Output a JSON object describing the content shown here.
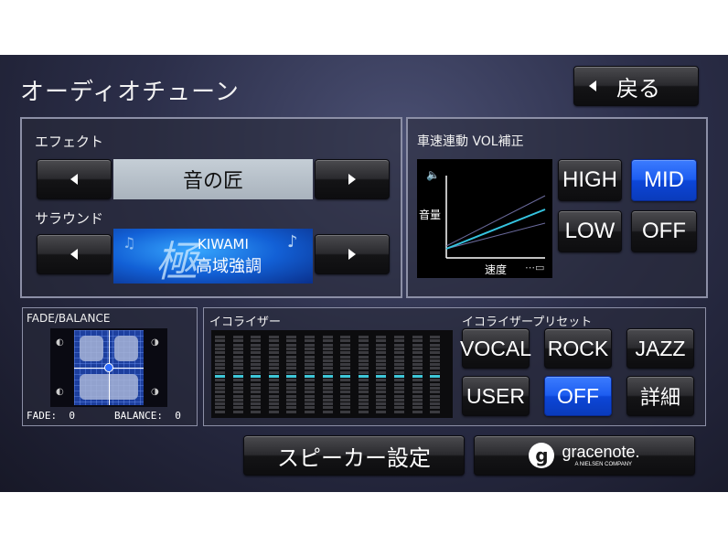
{
  "header": {
    "title": "オーディオチューン",
    "back_label": "戻る"
  },
  "effect": {
    "label": "エフェクト",
    "value": "音の匠"
  },
  "surround": {
    "label": "サラウンド",
    "logo_text": "KIWAMI",
    "logo_subtext": "高域強調",
    "logo_kanji": "極"
  },
  "vol": {
    "label": "車速連動 VOL補正",
    "graph_ylabel": "音量",
    "graph_xlabel": "速度",
    "buttons": [
      {
        "label": "HIGH",
        "active": false
      },
      {
        "label": "MID",
        "active": true
      },
      {
        "label": "LOW",
        "active": false
      },
      {
        "label": "OFF",
        "active": false
      }
    ]
  },
  "fade_balance": {
    "label": "FADE/BALANCE",
    "fade_text": "FADE:  0",
    "balance_text": "BALANCE:  0",
    "fade_value": 0,
    "balance_value": 0
  },
  "equalizer": {
    "label": "イコライザー",
    "bands": 13,
    "levels": [
      0,
      0,
      0,
      0,
      0,
      0,
      0,
      0,
      0,
      0,
      0,
      0,
      0
    ]
  },
  "eq_preset": {
    "label": "イコライザープリセット",
    "buttons": [
      {
        "label": "VOCAL",
        "active": false
      },
      {
        "label": "ROCK",
        "active": false
      },
      {
        "label": "JAZZ",
        "active": false
      },
      {
        "label": "USER",
        "active": false
      },
      {
        "label": "OFF",
        "active": true
      },
      {
        "label": "詳細",
        "active": false
      }
    ]
  },
  "footer": {
    "speaker_label": "スピーカー設定",
    "gracenote_label": "gracenote.",
    "gracenote_sub": "A NIELSEN COMPANY"
  },
  "colors": {
    "accent_blue": "#1d5df0",
    "eq_level": "#3ec7d8",
    "graph_line": "#35c4e0"
  }
}
